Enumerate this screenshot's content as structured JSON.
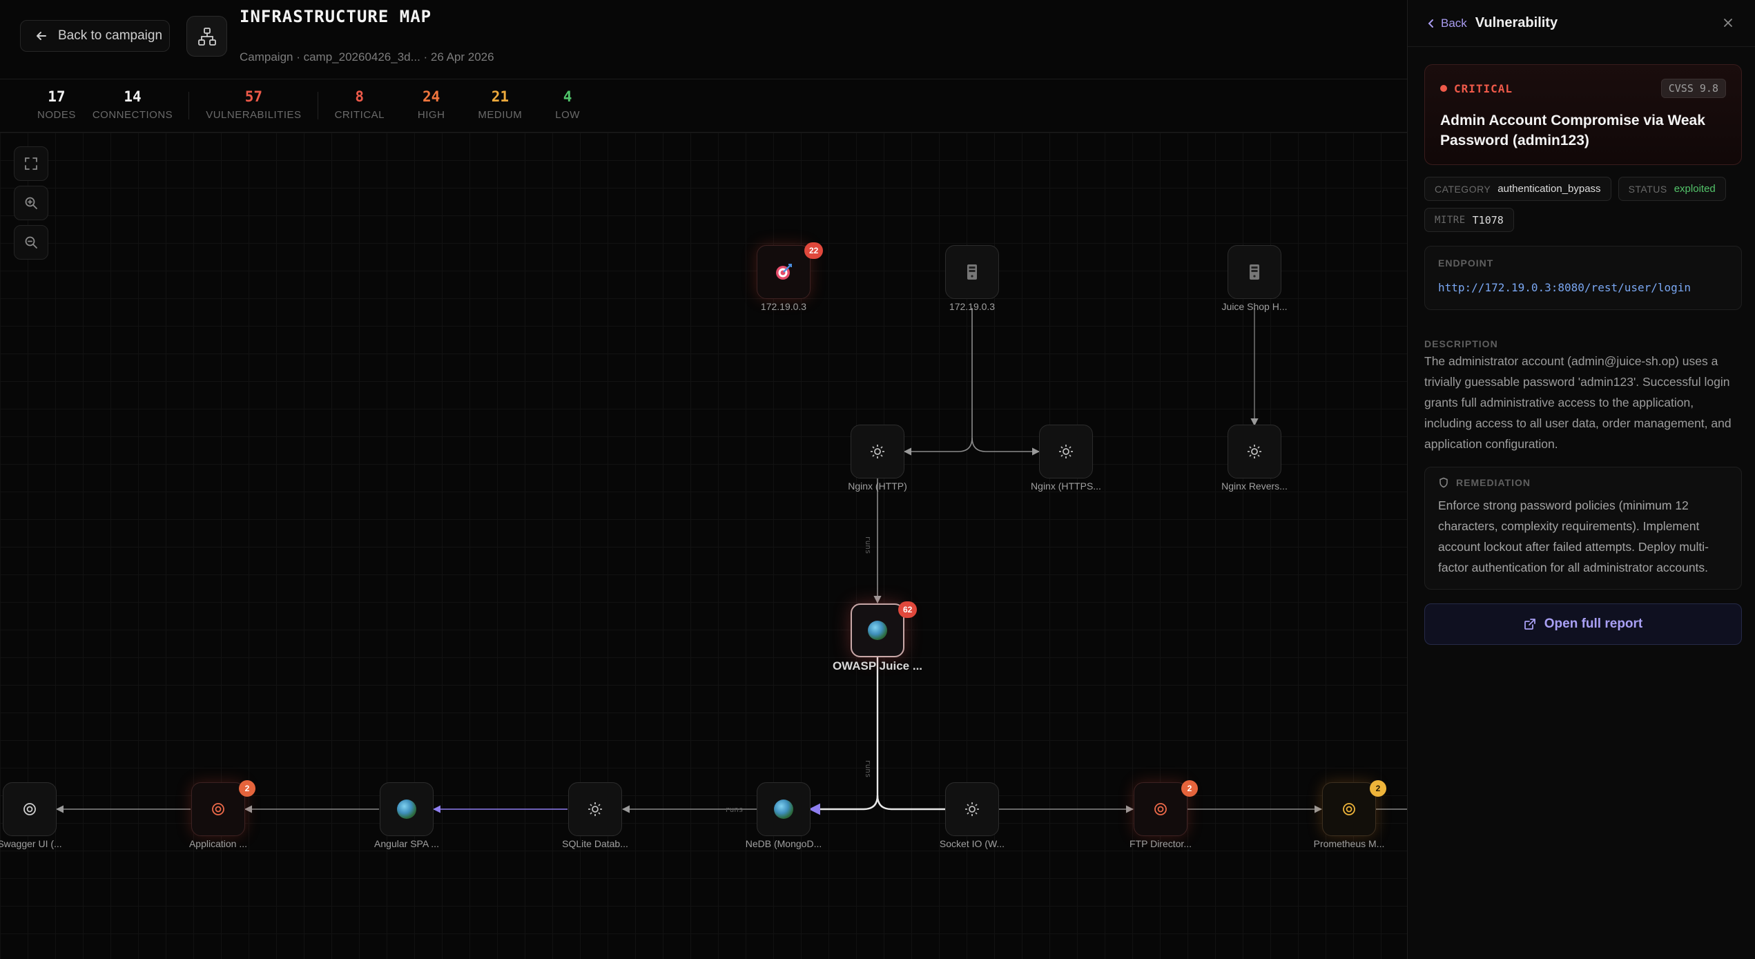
{
  "header": {
    "back_label": "Back to campaign",
    "title": "INFRASTRUCTURE MAP",
    "subtitle": "Campaign · camp_20260426_3d... · 26 Apr 2026"
  },
  "stats": [
    {
      "value": "17",
      "label": "NODES",
      "color": "#f2f2f2"
    },
    {
      "value": "14",
      "label": "CONNECTIONS",
      "color": "#f2f2f2"
    },
    {
      "value": "57",
      "label": "VULNERABILITIES",
      "color": "#ee5a4a"
    },
    {
      "value": "8",
      "label": "CRITICAL",
      "color": "#ee5a4a"
    },
    {
      "value": "24",
      "label": "HIGH",
      "color": "#f0763e"
    },
    {
      "value": "21",
      "label": "MEDIUM",
      "color": "#eeaa3c"
    },
    {
      "value": "4",
      "label": "LOW",
      "color": "#4fc46a"
    }
  ],
  "nodes": {
    "target": {
      "label": "172.19.0.3",
      "badge": "22",
      "icon": "target-icon"
    },
    "host2": {
      "label": "172.19.0.3",
      "icon": "server-icon"
    },
    "juice_host": {
      "label": "Juice Shop H...",
      "icon": "server-icon"
    },
    "nginx_http": {
      "label": "Nginx (HTTP)",
      "icon": "gear-icon"
    },
    "nginx_https": {
      "label": "Nginx (HTTPS...",
      "icon": "gear-icon"
    },
    "nginx_rev": {
      "label": "Nginx Revers...",
      "icon": "gear-icon"
    },
    "owasp": {
      "label": "OWASP Juice ...",
      "badge": "62",
      "icon": "globe-icon"
    },
    "swagger": {
      "label": "Swagger UI (...",
      "icon": "radar-icon"
    },
    "application": {
      "label": "Application ...",
      "badge": "2",
      "icon": "radar-icon"
    },
    "angular": {
      "label": "Angular SPA ...",
      "icon": "globe-icon"
    },
    "sqlite": {
      "label": "SQLite Datab...",
      "icon": "gear-icon"
    },
    "nedb": {
      "label": "NeDB (MongoD...",
      "icon": "globe-icon"
    },
    "socketio": {
      "label": "Socket IO (W...",
      "icon": "gear-icon"
    },
    "ftp": {
      "label": "FTP Director...",
      "badge": "2",
      "icon": "radar-icon"
    },
    "prometheus": {
      "label": "Prometheus M...",
      "badge": "2",
      "icon": "radar-icon"
    }
  },
  "edges": {
    "label_runs": "runs",
    "label_runs_b": "runs",
    "label_runs_c": "runs"
  },
  "panel": {
    "back_label": "Back",
    "title": "Vulnerability",
    "severity": "CRITICAL",
    "cvss": "CVSS 9.8",
    "vuln_title": "Admin Account Compromise via Weak Password (admin123)",
    "category_key": "CATEGORY",
    "category_value": "authentication_bypass",
    "status_key": "STATUS",
    "status_value": "exploited",
    "mitre_key": "MITRE",
    "mitre_value": "T1078",
    "endpoint_label": "ENDPOINT",
    "endpoint_url": "http://172.19.0.3:8080/rest/user/login",
    "description_label": "DESCRIPTION",
    "description": "The administrator account (admin@juice-sh.op) uses a trivially guessable password 'admin123'. Successful login grants full administrative access to the application, including access to all user data, order management, and application configuration.",
    "remediation_label": "REMEDIATION",
    "remediation": "Enforce strong password policies (minimum 12 characters, complexity requirements). Implement account lockout after failed attempts. Deploy multi-factor authentication for all administrator accounts.",
    "report_label": "Open full report"
  }
}
